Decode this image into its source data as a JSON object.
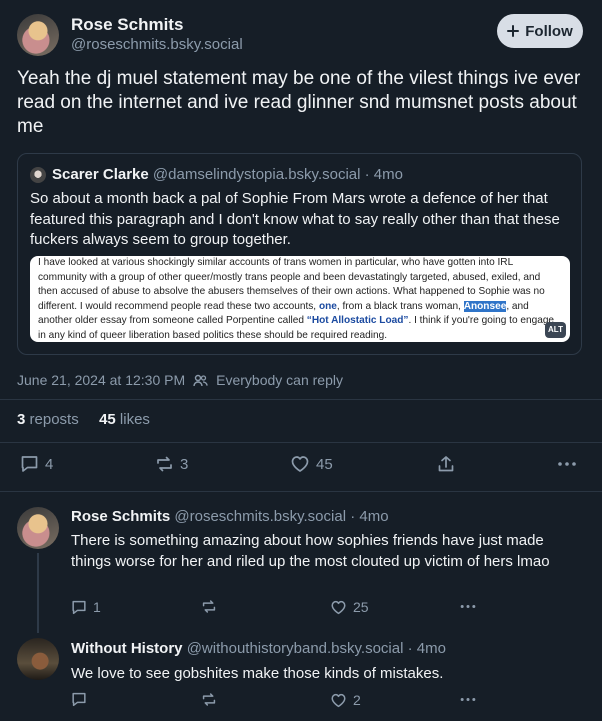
{
  "post": {
    "author_name": "Rose Schmits",
    "author_handle": "@roseschmits.bsky.social",
    "follow_label": "Follow",
    "text": "Yeah the dj muel statement may be one of the vilest things ive ever read on the internet and ive read glinner snd mumsnet posts about me",
    "quote": {
      "author_name": "Scarer Clarke",
      "author_handle": "@damselindystopia.bsky.social",
      "time": "· 4mo",
      "text": "So about a month back a pal of Sophie From Mars wrote a defence of her that featured this paragraph and I don't know what to say really other than that these fuckers always seem to group together.",
      "image_lines": [
        "I have looked at various shockingly similar accounts of trans women in particular, who have gotten into IRL",
        "community with a group of other queer/mostly trans people and been devastatingly targeted, abused, exiled, and",
        "then accused of abuse to absolve the abusers themselves of their own actions. What happened to Sophie was no",
        "different. I would recommend people read these two accounts,",
        "one",
        ", from a black trans woman,",
        "Anonsee",
        ", and",
        "another older essay from someone called Porpentine called",
        "“Hot Allostatic Load”",
        ". I think if you're going to engage",
        "in any kind of queer liberation based politics these should be required reading."
      ],
      "alt_label": "ALT"
    },
    "timestamp": "June 21, 2024 at 12:30 PM",
    "reply_setting": "Everybody can reply",
    "reposts_count": "3",
    "reposts_label": "reposts",
    "likes_count": "45",
    "likes_label": "likes",
    "actions": {
      "reply_count": "4",
      "repost_count": "3",
      "like_count": "45"
    }
  },
  "replies": [
    {
      "author_name": "Rose Schmits",
      "author_handle": "@roseschmits.bsky.social",
      "time": "· 4mo",
      "text": "There is something amazing about how sophies friends have just made things worse for her and riled up the most clouted up victim of hers lmao",
      "reply_count": "1",
      "repost_count": "",
      "like_count": "25"
    },
    {
      "author_name": "Without History",
      "author_handle": "@withouthistoryband.bsky.social",
      "time": "· 4mo",
      "text": "We love to see gobshites make those kinds of mistakes.",
      "reply_count": "",
      "repost_count": "",
      "like_count": "2"
    }
  ],
  "colors": {
    "background": "#161e27",
    "muted_text": "#8c9bab",
    "border": "#2e3a48",
    "follow_button_bg": "#d8dee6"
  },
  "icons": [
    "plus-icon",
    "people-icon",
    "reply-icon",
    "repost-icon",
    "heart-icon",
    "share-icon",
    "more-icon"
  ]
}
